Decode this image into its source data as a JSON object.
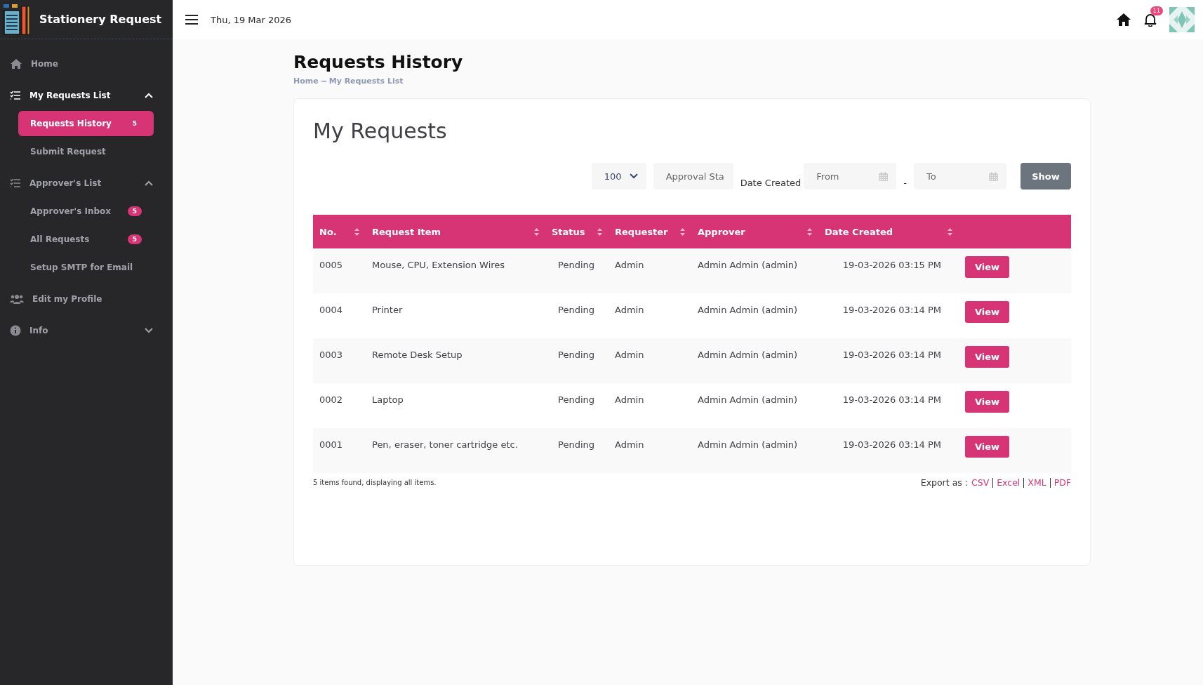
{
  "app": {
    "title": "Stationery Request"
  },
  "topbar": {
    "date": "Thu, 19 Mar 2026",
    "notifications": "11"
  },
  "sidebar": {
    "items": [
      {
        "kind": "link",
        "label": "Home",
        "selected": false
      },
      {
        "kind": "group",
        "label": "My Requests List",
        "expanded": true,
        "active": true,
        "children": [
          {
            "label": "Requests History",
            "badge": "5",
            "selected": true
          },
          {
            "label": "Submit Request",
            "selected": false
          }
        ]
      },
      {
        "kind": "group",
        "label": "Approver's List",
        "expanded": true,
        "active": false,
        "children": [
          {
            "label": "Approver's Inbox",
            "badge": "5",
            "selected": false
          },
          {
            "label": "All Requests",
            "badge": "5",
            "selected": false
          },
          {
            "label": "Setup SMTP for Email",
            "selected": false
          }
        ]
      },
      {
        "kind": "link",
        "label": "Edit my Profile",
        "selected": false
      },
      {
        "kind": "group",
        "label": "Info",
        "expanded": false,
        "active": false
      }
    ]
  },
  "page": {
    "title": "Requests History",
    "breadcrumb": [
      "Home",
      "My Requests List"
    ]
  },
  "card": {
    "title": "My Requests",
    "filters": {
      "page_size": "100",
      "approval_status": "Approval Sta",
      "date_label": "Date Created",
      "from_placeholder": "From",
      "separator": "-",
      "to_placeholder": "To",
      "button": "Show"
    },
    "table": {
      "columns": [
        "No.",
        "Request Item",
        "Status",
        "Requester",
        "Approver",
        "Date Created"
      ],
      "rows": [
        {
          "no": "0005",
          "item": "Mouse, CPU, Extension Wires",
          "status": "Pending",
          "requester": "Admin",
          "approver": "Admin Admin (admin)",
          "date": "19-03-2026 03:15 PM",
          "action": "View"
        },
        {
          "no": "0004",
          "item": "Printer",
          "status": "Pending",
          "requester": "Admin",
          "approver": "Admin Admin (admin)",
          "date": "19-03-2026 03:14 PM",
          "action": "View"
        },
        {
          "no": "0003",
          "item": "Remote Desk Setup",
          "status": "Pending",
          "requester": "Admin",
          "approver": "Admin Admin (admin)",
          "date": "19-03-2026 03:14 PM",
          "action": "View"
        },
        {
          "no": "0002",
          "item": "Laptop",
          "status": "Pending",
          "requester": "Admin",
          "approver": "Admin Admin (admin)",
          "date": "19-03-2026 03:14 PM",
          "action": "View"
        },
        {
          "no": "0001",
          "item": "Pen, eraser, toner cartridge etc.",
          "status": "Pending",
          "requester": "Admin",
          "approver": "Admin Admin (admin)",
          "date": "19-03-2026 03:14 PM",
          "action": "View"
        }
      ]
    },
    "summary": "5 items found, displaying all items.",
    "export": {
      "label": "Export as :",
      "formats": [
        "CSV",
        "Excel",
        "XML",
        "PDF"
      ]
    }
  }
}
